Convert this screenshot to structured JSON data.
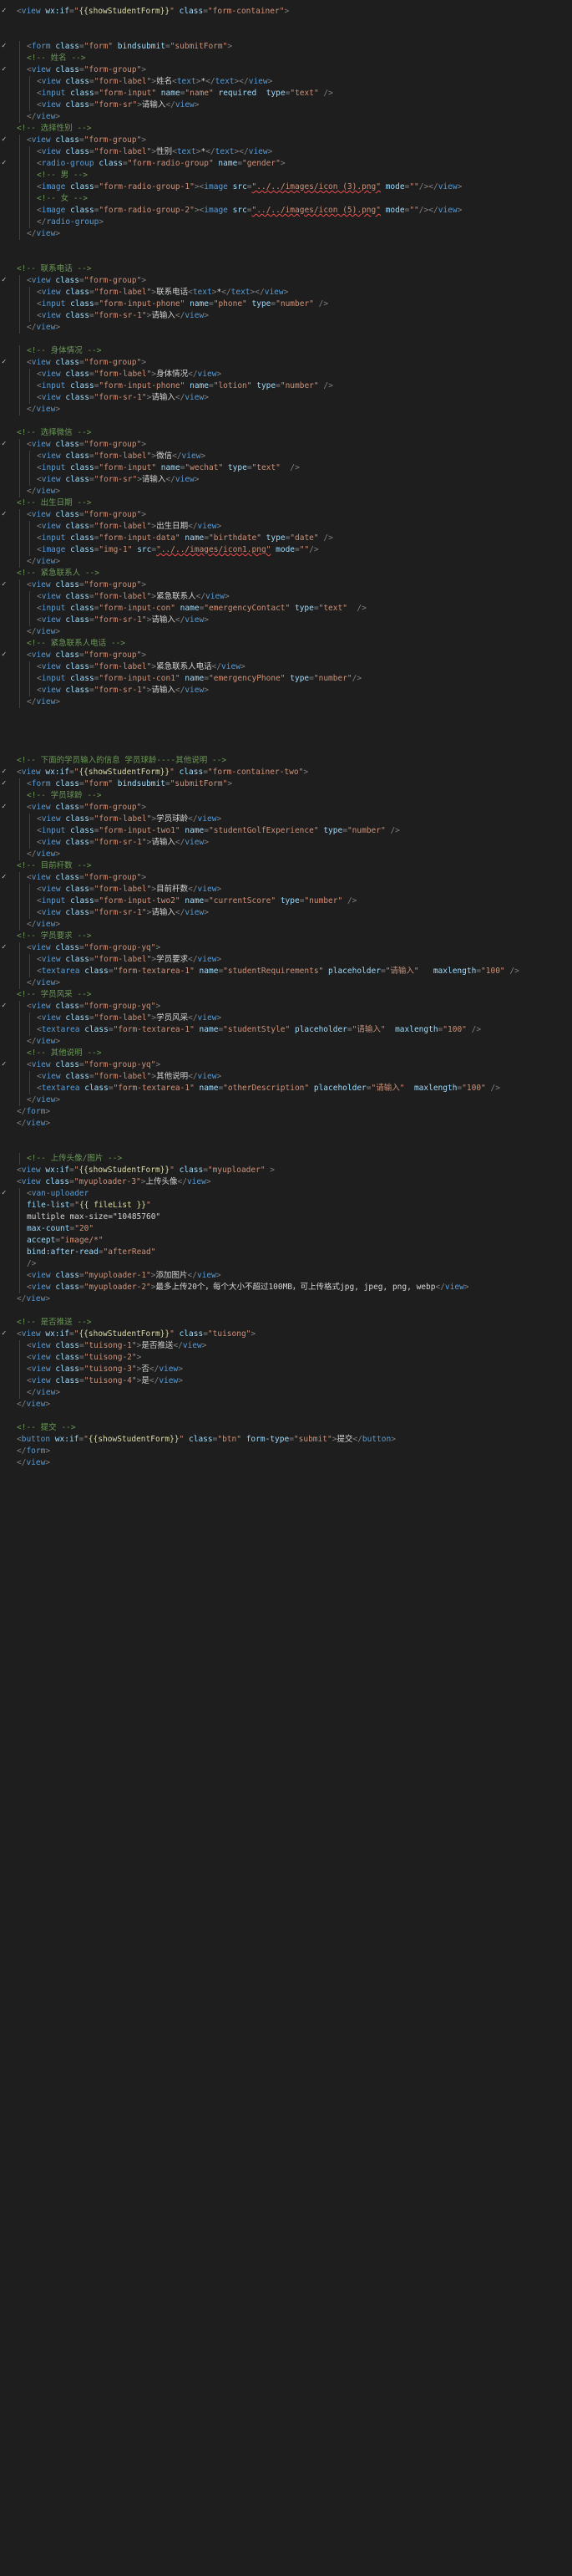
{
  "editor": {
    "language": "wxml",
    "lines": [
      {
        "i": 0,
        "s": "<view wx:if=\"{{showStudentForm}}\" class=\"form-container\">",
        "f": 1
      },
      {
        "i": 0,
        "s": ""
      },
      {
        "i": 0,
        "s": ""
      },
      {
        "i": 1,
        "s": "<form class=\"form\" bindsubmit=\"submitForm\">",
        "f": 1
      },
      {
        "i": 1,
        "s": "<!-- 姓名 -->"
      },
      {
        "i": 1,
        "s": "<view class=\"form-group\">",
        "f": 1
      },
      {
        "i": 2,
        "s": "<view class=\"form-label\">姓名<text>*</text></view>"
      },
      {
        "i": 2,
        "s": "<input class=\"form-input\" name=\"name\" required  type=\"text\" />"
      },
      {
        "i": 2,
        "s": "<view class=\"form-sr\">请输入</view>"
      },
      {
        "i": 1,
        "s": "</view>"
      },
      {
        "i": 0,
        "s": "<!-- 选择性别 -->"
      },
      {
        "i": 1,
        "s": "<view class=\"form-group\">",
        "f": 1
      },
      {
        "i": 2,
        "s": "<view class=\"form-label\">性别<text>*</text></view>"
      },
      {
        "i": 2,
        "s": "<radio-group class=\"form-radio-group\" name=\"gender\">",
        "f": 1
      },
      {
        "i": 2,
        "s": "<!-- 男 -->"
      },
      {
        "i": 2,
        "s": "<image class=\"form-radio-group-1\"><image src=\"../../images/icon (3).png\" mode=\"\"/></view>"
      },
      {
        "i": 2,
        "s": "<!-- 女 -->"
      },
      {
        "i": 2,
        "s": "<image class=\"form-radio-group-2\"><image src=\"../../images/icon (5).png\" mode=\"\"/></view>"
      },
      {
        "i": 2,
        "s": "</radio-group>"
      },
      {
        "i": 1,
        "s": "</view>"
      },
      {
        "i": 0,
        "s": ""
      },
      {
        "i": 0,
        "s": ""
      },
      {
        "i": 0,
        "s": "<!-- 联系电话 -->"
      },
      {
        "i": 1,
        "s": "<view class=\"form-group\">",
        "f": 1
      },
      {
        "i": 2,
        "s": "<view class=\"form-label\">联系电话<text>*</text></view>"
      },
      {
        "i": 2,
        "s": "<input class=\"form-input-phone\" name=\"phone\" type=\"number\" />"
      },
      {
        "i": 2,
        "s": "<view class=\"form-sr-1\">请输入</view>"
      },
      {
        "i": 1,
        "s": "</view>"
      },
      {
        "i": 0,
        "s": ""
      },
      {
        "i": 1,
        "s": "<!-- 身体情况 -->"
      },
      {
        "i": 1,
        "s": "<view class=\"form-group\">",
        "f": 1
      },
      {
        "i": 2,
        "s": "<view class=\"form-label\">身体情况</view>"
      },
      {
        "i": 2,
        "s": "<input class=\"form-input-phone\" name=\"lotion\" type=\"number\" />"
      },
      {
        "i": 2,
        "s": "<view class=\"form-sr-1\">请输入</view>"
      },
      {
        "i": 1,
        "s": "</view>"
      },
      {
        "i": 0,
        "s": ""
      },
      {
        "i": 0,
        "s": "<!-- 选择微信 -->"
      },
      {
        "i": 1,
        "s": "<view class=\"form-group\">",
        "f": 1
      },
      {
        "i": 2,
        "s": "<view class=\"form-label\">微信</view>"
      },
      {
        "i": 2,
        "s": "<input class=\"form-input\" name=\"wechat\" type=\"text\"  />"
      },
      {
        "i": 2,
        "s": "<view class=\"form-sr\">请输入</view>"
      },
      {
        "i": 1,
        "s": "</view>"
      },
      {
        "i": 0,
        "s": "<!-- 出生日期 -->"
      },
      {
        "i": 1,
        "s": "<view class=\"form-group\">",
        "f": 1
      },
      {
        "i": 2,
        "s": "<view class=\"form-label\">出生日期</view>"
      },
      {
        "i": 2,
        "s": "<input class=\"form-input-data\" name=\"birthdate\" type=\"date\" />"
      },
      {
        "i": 2,
        "s": "<image class=\"img-1\" src=\"../../images/icon1.png\" mode=\"\"/>"
      },
      {
        "i": 1,
        "s": "</view>"
      },
      {
        "i": 0,
        "s": "<!-- 紧急联系人 -->"
      },
      {
        "i": 1,
        "s": "<view class=\"form-group\">",
        "f": 1
      },
      {
        "i": 2,
        "s": "<view class=\"form-label\">紧急联系人</view>"
      },
      {
        "i": 2,
        "s": "<input class=\"form-input-con\" name=\"emergencyContact\" type=\"text\"  />"
      },
      {
        "i": 2,
        "s": "<view class=\"form-sr-1\">请输入</view>"
      },
      {
        "i": 1,
        "s": "</view>"
      },
      {
        "i": 1,
        "s": "<!-- 紧急联系人电话 -->"
      },
      {
        "i": 1,
        "s": "<view class=\"form-group\">",
        "f": 1
      },
      {
        "i": 2,
        "s": "<view class=\"form-label\">紧急联系人电话</view>"
      },
      {
        "i": 2,
        "s": "<input class=\"form-input-con1\" name=\"emergencyPhone\" type=\"number\"/>"
      },
      {
        "i": 2,
        "s": "<view class=\"form-sr-1\">请输入</view>"
      },
      {
        "i": 1,
        "s": "</view>"
      },
      {
        "i": 0,
        "s": ""
      },
      {
        "i": 0,
        "s": ""
      },
      {
        "i": 0,
        "s": ""
      },
      {
        "i": 0,
        "s": ""
      },
      {
        "i": 0,
        "s": "<!-- 下面的学员输入的信息 学员球龄----其他说明 -->"
      },
      {
        "i": 0,
        "s": "<view wx:if=\"{{showStudentForm}}\" class=\"form-container-two\">",
        "f": 1
      },
      {
        "i": 1,
        "s": "<form class=\"form\" bindsubmit=\"submitForm\">",
        "f": 1
      },
      {
        "i": 1,
        "s": "<!-- 学员球龄 -->"
      },
      {
        "i": 1,
        "s": "<view class=\"form-group\">",
        "f": 1
      },
      {
        "i": 2,
        "s": "<view class=\"form-label\">学员球龄</view>"
      },
      {
        "i": 2,
        "s": "<input class=\"form-input-two1\" name=\"studentGolfExperience\" type=\"number\" />"
      },
      {
        "i": 2,
        "s": "<view class=\"form-sr-1\">请输入</view>"
      },
      {
        "i": 1,
        "s": "</view>"
      },
      {
        "i": 0,
        "s": "<!-- 目前杆数 -->"
      },
      {
        "i": 1,
        "s": "<view class=\"form-group\">",
        "f": 1
      },
      {
        "i": 2,
        "s": "<view class=\"form-label\">目前杆数</view>"
      },
      {
        "i": 2,
        "s": "<input class=\"form-input-two2\" name=\"currentScore\" type=\"number\" />"
      },
      {
        "i": 2,
        "s": "<view class=\"form-sr-1\">请输入</view>"
      },
      {
        "i": 1,
        "s": "</view>"
      },
      {
        "i": 0,
        "s": "<!-- 学员要求 -->"
      },
      {
        "i": 1,
        "s": "<view class=\"form-group-yq\">",
        "f": 1
      },
      {
        "i": 2,
        "s": "<view class=\"form-label\">学员要求</view>"
      },
      {
        "i": 2,
        "s": "<textarea class=\"form-textarea-1\" name=\"studentRequirements\" placeholder=\"请输入\"   maxlength=\"100\" />"
      },
      {
        "i": 1,
        "s": "</view>"
      },
      {
        "i": 0,
        "s": "<!-- 学员风采 -->"
      },
      {
        "i": 1,
        "s": "<view class=\"form-group-yq\">",
        "f": 1
      },
      {
        "i": 2,
        "s": "<view class=\"form-label\">学员风采</view>"
      },
      {
        "i": 2,
        "s": "<textarea class=\"form-textarea-1\" name=\"studentStyle\" placeholder=\"请输入\"  maxlength=\"100\" />"
      },
      {
        "i": 1,
        "s": "</view>"
      },
      {
        "i": 1,
        "s": "<!-- 其他说明 -->"
      },
      {
        "i": 1,
        "s": "<view class=\"form-group-yq\">",
        "f": 1
      },
      {
        "i": 2,
        "s": "<view class=\"form-label\">其他说明</view>"
      },
      {
        "i": 2,
        "s": "<textarea class=\"form-textarea-1\" name=\"otherDescription\" placeholder=\"请输入\"  maxlength=\"100\" />"
      },
      {
        "i": 1,
        "s": "</view>"
      },
      {
        "i": 0,
        "s": "</form>"
      },
      {
        "i": 0,
        "s": "</view>"
      },
      {
        "i": 0,
        "s": ""
      },
      {
        "i": 0,
        "s": ""
      },
      {
        "i": 1,
        "s": "<!-- 上传头像/图片 -->"
      },
      {
        "i": 0,
        "s": "<view wx:if=\"{{showStudentForm}}\" class=\"myuploader\" >"
      },
      {
        "i": 0,
        "s": "<view class=\"myuploader-3\">上传头像</view>"
      },
      {
        "i": 1,
        "s": "<van-uploader",
        "f": 1
      },
      {
        "i": 1,
        "s": "file-list=\"{{ fileList }}\""
      },
      {
        "i": 1,
        "s": "multiple max-size=\"10485760\""
      },
      {
        "i": 1,
        "s": "max-count=\"20\""
      },
      {
        "i": 1,
        "s": "accept=\"image/*\""
      },
      {
        "i": 1,
        "s": "bind:after-read=\"afterRead\""
      },
      {
        "i": 1,
        "s": "/>"
      },
      {
        "i": 1,
        "s": "<view class=\"myuploader-1\">添加图片</view>"
      },
      {
        "i": 1,
        "s": "<view class=\"myuploader-2\">最多上传20个，每个大小不超过100MB，可上传格式jpg, jpeg, png, webp</view>"
      },
      {
        "i": 0,
        "s": "</view>"
      },
      {
        "i": 0,
        "s": ""
      },
      {
        "i": 0,
        "s": "<!-- 是否推送 -->"
      },
      {
        "i": 0,
        "s": "<view wx:if=\"{{showStudentForm}}\" class=\"tuisong\">",
        "f": 1
      },
      {
        "i": 1,
        "s": "<view class=\"tuisong-1\">是否推送</view>"
      },
      {
        "i": 1,
        "s": "<view class=\"tuisong-2\">"
      },
      {
        "i": 1,
        "s": "<view class=\"tuisong-3\">否</view>"
      },
      {
        "i": 1,
        "s": "<view class=\"tuisong-4\">是</view>"
      },
      {
        "i": 1,
        "s": "</view>"
      },
      {
        "i": 0,
        "s": "</view>"
      },
      {
        "i": 0,
        "s": ""
      },
      {
        "i": 0,
        "s": "<!-- 提交 -->"
      },
      {
        "i": 0,
        "s": "<button wx:if=\"{{showStudentForm}}\" class=\"btn\" form-type=\"submit\">提交</button>"
      },
      {
        "i": 0,
        "s": "</form>"
      },
      {
        "i": 0,
        "s": "</view>"
      }
    ]
  }
}
